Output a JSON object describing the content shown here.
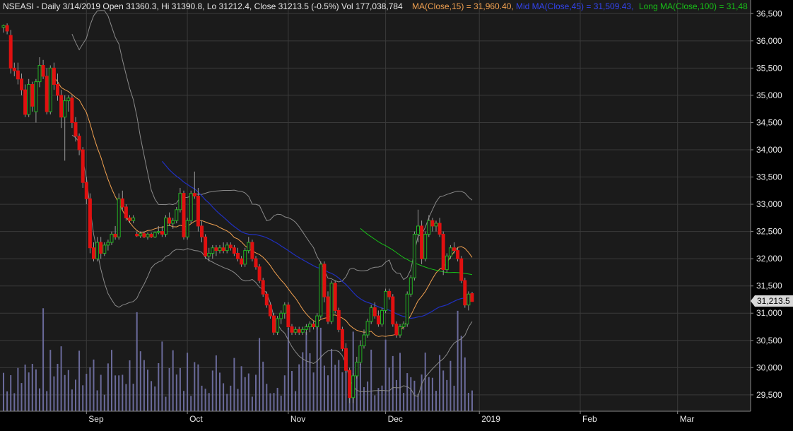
{
  "header": {
    "symbol_info": "NSEASI - Daily 3/14/2019 Open 31360.3, Hi 31390.8, Lo 31212.4, Close 31213.5 (-0.5%) Vol 177,038,784",
    "ma15": "MA(Close,15) = 31,960.40,",
    "ma45": "Mid MA(Close,45) = 31,509.43,",
    "ma100": "Long MA(Close,100) = 31,48"
  },
  "last_price_label": "31,213.5",
  "colors": {
    "background": "#000000",
    "panel": "#1b1b1b",
    "grid": "#3a3a3a",
    "up": "#22b022",
    "down": "#e01010",
    "ma15": "#f0a050",
    "ma45": "#2030c0",
    "ma100": "#18c018",
    "bands": "#8a8a8a",
    "volume": "#6a6a9a",
    "text": "#e6e6e6",
    "ma45_label": "#3344ee"
  },
  "chart_data": {
    "type": "candlestick",
    "symbol": "NSEASI",
    "ylim": [
      29200,
      36750
    ],
    "y_ticks": [
      29500,
      30000,
      30500,
      31000,
      31500,
      32000,
      32500,
      33000,
      33500,
      34000,
      34500,
      35000,
      35500,
      36000,
      36500
    ],
    "y_tick_labels": [
      "29,500",
      "30,000",
      "30,500",
      "31,000",
      "31,500",
      "32,000",
      "32,500",
      "33,000",
      "33,500",
      "34,000",
      "34,500",
      "35,000",
      "35,500",
      "36,000",
      "36,500"
    ],
    "x_labels": [
      {
        "label": "Sep",
        "bar": 23
      },
      {
        "label": "Oct",
        "bar": 51
      },
      {
        "label": "Nov",
        "bar": 79
      },
      {
        "label": "Dec",
        "bar": 106
      },
      {
        "label": "2019",
        "bar": 132
      },
      {
        "label": "Feb",
        "bar": 160
      },
      {
        "label": "Mar",
        "bar": 187
      }
    ],
    "candles": [
      {
        "o": 36250,
        "h": 36300,
        "l": 36150,
        "c": 36280
      },
      {
        "o": 36280,
        "h": 36320,
        "l": 36120,
        "c": 36180
      },
      {
        "o": 36100,
        "h": 36200,
        "l": 35400,
        "c": 35500
      },
      {
        "o": 35500,
        "h": 35600,
        "l": 35350,
        "c": 35450
      },
      {
        "o": 35450,
        "h": 35600,
        "l": 35200,
        "c": 35300
      },
      {
        "o": 35300,
        "h": 35400,
        "l": 35000,
        "c": 35100
      },
      {
        "o": 35100,
        "h": 35200,
        "l": 34600,
        "c": 34650
      },
      {
        "o": 34650,
        "h": 35300,
        "l": 34600,
        "c": 35200
      },
      {
        "o": 35200,
        "h": 35250,
        "l": 34700,
        "c": 34800
      },
      {
        "o": 34700,
        "h": 35300,
        "l": 34500,
        "c": 35250
      },
      {
        "o": 35250,
        "h": 35700,
        "l": 35150,
        "c": 35550
      },
      {
        "o": 35550,
        "h": 35650,
        "l": 35300,
        "c": 35350
      },
      {
        "o": 35350,
        "h": 35500,
        "l": 34650,
        "c": 34700
      },
      {
        "o": 34700,
        "h": 35550,
        "l": 34650,
        "c": 35500
      },
      {
        "o": 35500,
        "h": 35600,
        "l": 35100,
        "c": 35200
      },
      {
        "o": 35200,
        "h": 35400,
        "l": 34900,
        "c": 35000
      },
      {
        "o": 35000,
        "h": 35100,
        "l": 34400,
        "c": 34600
      },
      {
        "o": 34600,
        "h": 35000,
        "l": 33800,
        "c": 34900
      },
      {
        "o": 34900,
        "h": 35000,
        "l": 34700,
        "c": 34950
      },
      {
        "o": 34950,
        "h": 35000,
        "l": 34400,
        "c": 34500
      },
      {
        "o": 34500,
        "h": 34600,
        "l": 34150,
        "c": 34250
      },
      {
        "o": 34250,
        "h": 34300,
        "l": 33900,
        "c": 34000
      },
      {
        "o": 34000,
        "h": 34050,
        "l": 33300,
        "c": 33400
      },
      {
        "o": 33400,
        "h": 33500,
        "l": 33000,
        "c": 33100
      },
      {
        "o": 33100,
        "h": 33200,
        "l": 32100,
        "c": 32200
      },
      {
        "o": 32200,
        "h": 32300,
        "l": 31950,
        "c": 32000
      },
      {
        "o": 32000,
        "h": 32400,
        "l": 31950,
        "c": 32300
      },
      {
        "o": 32300,
        "h": 32400,
        "l": 32000,
        "c": 32100
      },
      {
        "o": 32100,
        "h": 32300,
        "l": 32050,
        "c": 32250
      },
      {
        "o": 32250,
        "h": 32350,
        "l": 32150,
        "c": 32300
      },
      {
        "o": 32300,
        "h": 32500,
        "l": 32250,
        "c": 32450
      },
      {
        "o": 32450,
        "h": 32600,
        "l": 32350,
        "c": 32400
      },
      {
        "o": 32400,
        "h": 33200,
        "l": 32350,
        "c": 33100
      },
      {
        "o": 33100,
        "h": 33250,
        "l": 32900,
        "c": 32950
      },
      {
        "o": 32950,
        "h": 33000,
        "l": 32700,
        "c": 32750
      },
      {
        "o": 32750,
        "h": 32800,
        "l": 32650,
        "c": 32700
      },
      {
        "o": 32700,
        "h": 32800,
        "l": 32650,
        "c": 32750
      },
      {
        "o": 32450,
        "h": 32500,
        "l": 32400,
        "c": 32420
      },
      {
        "o": 32420,
        "h": 32500,
        "l": 32380,
        "c": 32460
      },
      {
        "o": 32460,
        "h": 32500,
        "l": 32380,
        "c": 32400
      },
      {
        "o": 32400,
        "h": 32480,
        "l": 32350,
        "c": 32450
      },
      {
        "o": 32450,
        "h": 32480,
        "l": 32380,
        "c": 32400
      },
      {
        "o": 32400,
        "h": 32500,
        "l": 32380,
        "c": 32480
      },
      {
        "o": 32480,
        "h": 32600,
        "l": 32450,
        "c": 32500
      },
      {
        "o": 32500,
        "h": 32600,
        "l": 32400,
        "c": 32450
      },
      {
        "o": 32450,
        "h": 32800,
        "l": 32400,
        "c": 32750
      },
      {
        "o": 32750,
        "h": 32850,
        "l": 32600,
        "c": 32650
      },
      {
        "o": 32650,
        "h": 32750,
        "l": 32550,
        "c": 32700
      },
      {
        "o": 32700,
        "h": 32950,
        "l": 32650,
        "c": 32900
      },
      {
        "o": 32900,
        "h": 33300,
        "l": 32850,
        "c": 33200
      },
      {
        "o": 33200,
        "h": 33250,
        "l": 32350,
        "c": 32400
      },
      {
        "o": 32400,
        "h": 32750,
        "l": 32350,
        "c": 32700
      },
      {
        "o": 32700,
        "h": 33250,
        "l": 32650,
        "c": 33200
      },
      {
        "o": 33200,
        "h": 33600,
        "l": 33100,
        "c": 33150
      },
      {
        "o": 33150,
        "h": 33300,
        "l": 32500,
        "c": 32600
      },
      {
        "o": 32600,
        "h": 32700,
        "l": 32300,
        "c": 32400
      },
      {
        "o": 32400,
        "h": 32450,
        "l": 32000,
        "c": 32050
      },
      {
        "o": 32050,
        "h": 32200,
        "l": 31950,
        "c": 32100
      },
      {
        "o": 32100,
        "h": 32250,
        "l": 32000,
        "c": 32200
      },
      {
        "o": 32200,
        "h": 32250,
        "l": 32050,
        "c": 32150
      },
      {
        "o": 32150,
        "h": 32250,
        "l": 32100,
        "c": 32200
      },
      {
        "o": 32200,
        "h": 32300,
        "l": 32100,
        "c": 32150
      },
      {
        "o": 32150,
        "h": 32300,
        "l": 32100,
        "c": 32250
      },
      {
        "o": 32250,
        "h": 32300,
        "l": 32150,
        "c": 32200
      },
      {
        "o": 32200,
        "h": 32250,
        "l": 32050,
        "c": 32100
      },
      {
        "o": 32100,
        "h": 32200,
        "l": 31950,
        "c": 32000
      },
      {
        "o": 32000,
        "h": 32050,
        "l": 31850,
        "c": 31900
      },
      {
        "o": 31900,
        "h": 32200,
        "l": 31850,
        "c": 32150
      },
      {
        "o": 32150,
        "h": 32400,
        "l": 32100,
        "c": 32300
      },
      {
        "o": 32300,
        "h": 32350,
        "l": 31950,
        "c": 32000
      },
      {
        "o": 32000,
        "h": 32050,
        "l": 31800,
        "c": 31850
      },
      {
        "o": 31850,
        "h": 31900,
        "l": 31550,
        "c": 31600
      },
      {
        "o": 31600,
        "h": 31650,
        "l": 31300,
        "c": 31350
      },
      {
        "o": 31350,
        "h": 31400,
        "l": 31100,
        "c": 31150
      },
      {
        "o": 31150,
        "h": 31200,
        "l": 30900,
        "c": 30950
      },
      {
        "o": 30950,
        "h": 31000,
        "l": 30600,
        "c": 30650
      },
      {
        "o": 30650,
        "h": 30950,
        "l": 30600,
        "c": 30900
      },
      {
        "o": 30900,
        "h": 31050,
        "l": 30800,
        "c": 31000
      },
      {
        "o": 31000,
        "h": 31200,
        "l": 30900,
        "c": 31150
      },
      {
        "o": 31150,
        "h": 31200,
        "l": 30700,
        "c": 30750
      },
      {
        "o": 30750,
        "h": 30800,
        "l": 30600,
        "c": 30650
      },
      {
        "o": 30650,
        "h": 30750,
        "l": 30600,
        "c": 30700
      },
      {
        "o": 30700,
        "h": 30750,
        "l": 30600,
        "c": 30650
      },
      {
        "o": 30650,
        "h": 30750,
        "l": 30600,
        "c": 30700
      },
      {
        "o": 30700,
        "h": 30800,
        "l": 30600,
        "c": 30750
      },
      {
        "o": 30750,
        "h": 30850,
        "l": 30650,
        "c": 30800
      },
      {
        "o": 30800,
        "h": 30850,
        "l": 30700,
        "c": 30750
      },
      {
        "o": 30750,
        "h": 31000,
        "l": 30700,
        "c": 30950
      },
      {
        "o": 30950,
        "h": 31950,
        "l": 30900,
        "c": 31900
      },
      {
        "o": 31900,
        "h": 31950,
        "l": 31200,
        "c": 31300
      },
      {
        "o": 31300,
        "h": 31400,
        "l": 30800,
        "c": 30850
      },
      {
        "o": 30850,
        "h": 31600,
        "l": 30800,
        "c": 31550
      },
      {
        "o": 31550,
        "h": 31600,
        "l": 31000,
        "c": 31050
      },
      {
        "o": 31050,
        "h": 31100,
        "l": 30650,
        "c": 30700
      },
      {
        "o": 30700,
        "h": 30750,
        "l": 30300,
        "c": 30350
      },
      {
        "o": 30350,
        "h": 30450,
        "l": 29900,
        "c": 29950
      },
      {
        "o": 29950,
        "h": 30000,
        "l": 29350,
        "c": 29450
      },
      {
        "o": 29450,
        "h": 29900,
        "l": 29350,
        "c": 29850
      },
      {
        "o": 29850,
        "h": 30200,
        "l": 29800,
        "c": 30100
      },
      {
        "o": 30100,
        "h": 30500,
        "l": 30050,
        "c": 30400
      },
      {
        "o": 30400,
        "h": 30700,
        "l": 30350,
        "c": 30600
      },
      {
        "o": 30600,
        "h": 30900,
        "l": 30550,
        "c": 30850
      },
      {
        "o": 30850,
        "h": 31150,
        "l": 30800,
        "c": 31100
      },
      {
        "o": 31100,
        "h": 31200,
        "l": 30900,
        "c": 30950
      },
      {
        "o": 30950,
        "h": 31050,
        "l": 30750,
        "c": 30800
      },
      {
        "o": 30800,
        "h": 31100,
        "l": 30750,
        "c": 31050
      },
      {
        "o": 31050,
        "h": 31450,
        "l": 31000,
        "c": 31400
      },
      {
        "o": 31400,
        "h": 31450,
        "l": 31250,
        "c": 31300
      },
      {
        "o": 31300,
        "h": 31350,
        "l": 30750,
        "c": 30800
      },
      {
        "o": 30800,
        "h": 30850,
        "l": 30550,
        "c": 30600
      },
      {
        "o": 30600,
        "h": 30800,
        "l": 30550,
        "c": 30750
      },
      {
        "o": 30750,
        "h": 30850,
        "l": 30700,
        "c": 30800
      },
      {
        "o": 30800,
        "h": 31400,
        "l": 30750,
        "c": 31350
      },
      {
        "o": 31350,
        "h": 31700,
        "l": 31300,
        "c": 31650
      },
      {
        "o": 31650,
        "h": 32500,
        "l": 31600,
        "c": 32450
      },
      {
        "o": 32450,
        "h": 32900,
        "l": 32300,
        "c": 32600
      },
      {
        "o": 32600,
        "h": 32700,
        "l": 31900,
        "c": 32000
      },
      {
        "o": 32000,
        "h": 32500,
        "l": 31950,
        "c": 32450
      },
      {
        "o": 32450,
        "h": 32800,
        "l": 32400,
        "c": 32700
      },
      {
        "o": 32700,
        "h": 32750,
        "l": 32500,
        "c": 32600
      },
      {
        "o": 32600,
        "h": 32700,
        "l": 32500,
        "c": 32650
      },
      {
        "o": 32650,
        "h": 32750,
        "l": 32400,
        "c": 32450
      },
      {
        "o": 32450,
        "h": 32500,
        "l": 31700,
        "c": 31800
      },
      {
        "o": 31800,
        "h": 32100,
        "l": 31750,
        "c": 32050
      },
      {
        "o": 32050,
        "h": 32250,
        "l": 32000,
        "c": 32200
      },
      {
        "o": 32200,
        "h": 32300,
        "l": 32100,
        "c": 32150
      },
      {
        "o": 32150,
        "h": 32200,
        "l": 31950,
        "c": 32000
      },
      {
        "o": 32000,
        "h": 32050,
        "l": 31550,
        "c": 31600
      },
      {
        "o": 31600,
        "h": 31650,
        "l": 31100,
        "c": 31150
      },
      {
        "o": 31150,
        "h": 31400,
        "l": 31050,
        "c": 31350
      },
      {
        "o": 31360,
        "h": 31391,
        "l": 31212,
        "c": 31214
      }
    ]
  }
}
